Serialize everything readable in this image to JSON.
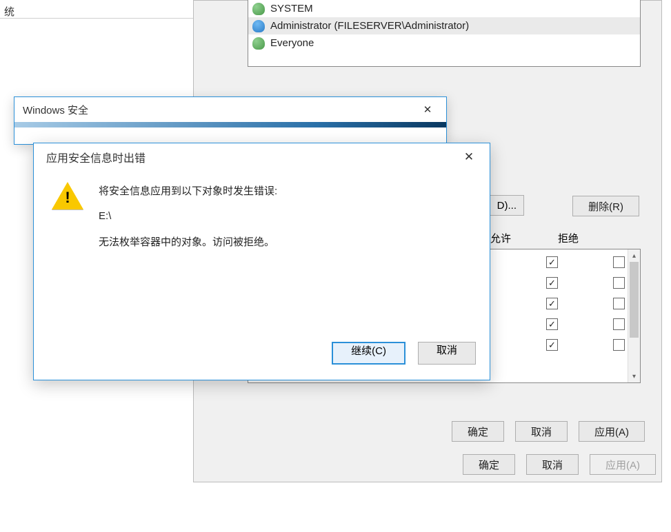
{
  "bg_fragment": "统",
  "perm_list": {
    "items": [
      {
        "icon": "group",
        "label": "SYSTEM"
      },
      {
        "icon": "user",
        "label": "Administrator (FILESERVER\\Administrator)"
      },
      {
        "icon": "group",
        "label": "Everyone"
      }
    ],
    "selected_index": 1
  },
  "buttons": {
    "add_partial": "D)...",
    "remove": "删除(R)",
    "ok": "确定",
    "cancel": "取消",
    "apply": "应用(A)"
  },
  "perm_cols": {
    "allow": "允许",
    "deny": "拒绝"
  },
  "perm_rows": [
    {
      "allow": true,
      "deny": false
    },
    {
      "allow": true,
      "deny": false
    },
    {
      "allow": true,
      "deny": false
    },
    {
      "allow": true,
      "deny": false
    },
    {
      "allow": true,
      "deny": false
    }
  ],
  "sec_dialog": {
    "title": "Windows 安全"
  },
  "err_dialog": {
    "title": "应用安全信息时出错",
    "line1": "将安全信息应用到以下对象时发生错误:",
    "path": "E:\\",
    "line2": "无法枚举容器中的对象。访问被拒绝。",
    "continue": "继续(C)",
    "cancel": "取消"
  }
}
